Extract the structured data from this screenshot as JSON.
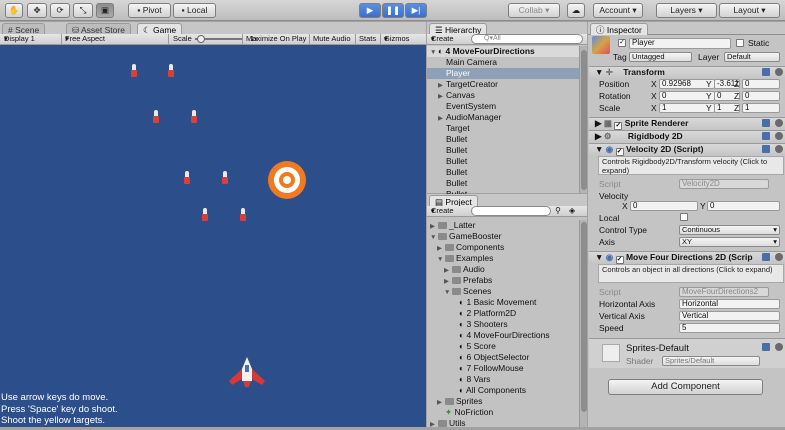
{
  "toolbar": {
    "pivot": "Pivot",
    "local": "Local",
    "collab": "Collab ▾",
    "account": "Account",
    "layers": "Layers",
    "layout": "Layout",
    "tools": [
      "hand-tool-icon",
      "move-tool-icon",
      "rotate-tool-icon",
      "scale-tool-icon",
      "rect-tool-icon"
    ]
  },
  "tabs": {
    "scene": "Scene",
    "asset_store": "Asset Store",
    "game": "Game",
    "hierarchy": "Hierarchy",
    "project": "Project",
    "inspector": "Inspector"
  },
  "game_bar": {
    "display": "Display 1",
    "aspect": "Free Aspect",
    "scale_label": "Scale",
    "scale_value": "1x",
    "maximize": "Maximize On Play",
    "mute": "Mute Audio",
    "stats": "Stats",
    "gizmos": "Gizmos"
  },
  "game_text": [
    "Use arrow keys do move.",
    "Press 'Space' key do shoot.",
    "Shoot the yellow targets."
  ],
  "hierarchy": {
    "create": "Create",
    "search_placeholder": "Q▾All",
    "scene": "4 MoveFourDirections",
    "items": [
      {
        "label": "Main Camera",
        "arrow": ""
      },
      {
        "label": "Player",
        "arrow": ""
      },
      {
        "label": "TargetCreator",
        "arrow": "▶"
      },
      {
        "label": "Canvas",
        "arrow": "▶"
      },
      {
        "label": "EventSystem",
        "arrow": ""
      },
      {
        "label": "AudioManager",
        "arrow": "▶"
      },
      {
        "label": "Target",
        "arrow": ""
      },
      {
        "label": "Bullet",
        "arrow": ""
      },
      {
        "label": "Bullet",
        "arrow": ""
      },
      {
        "label": "Bullet",
        "arrow": ""
      },
      {
        "label": "Bullet",
        "arrow": ""
      },
      {
        "label": "Bullet",
        "arrow": ""
      },
      {
        "label": "Bullet",
        "arrow": ""
      }
    ]
  },
  "project": {
    "create": "Create",
    "items": [
      {
        "label": "_Latter",
        "arrow": "▶",
        "type": "folder"
      },
      {
        "label": "GameBooster",
        "arrow": "▼",
        "type": "folder"
      },
      {
        "label": "Components",
        "arrow": "▶",
        "type": "folder"
      },
      {
        "label": "Examples",
        "arrow": "▼",
        "type": "folder"
      },
      {
        "label": "Audio",
        "arrow": "▶",
        "type": "folder"
      },
      {
        "label": "Prefabs",
        "arrow": "▶",
        "type": "folder"
      },
      {
        "label": "Scenes",
        "arrow": "▼",
        "type": "folder"
      },
      {
        "label": "1 Basic Movement",
        "arrow": "",
        "type": "scene"
      },
      {
        "label": "2 Platform2D",
        "arrow": "",
        "type": "scene"
      },
      {
        "label": "3 Shooters",
        "arrow": "",
        "type": "scene"
      },
      {
        "label": "4 MoveFourDirections",
        "arrow": "",
        "type": "scene"
      },
      {
        "label": "5 Score",
        "arrow": "",
        "type": "scene"
      },
      {
        "label": "6 ObjectSelector",
        "arrow": "",
        "type": "scene"
      },
      {
        "label": "7 FollowMouse",
        "arrow": "",
        "type": "scene"
      },
      {
        "label": "8 Vars",
        "arrow": "",
        "type": "scene"
      },
      {
        "label": "All Components",
        "arrow": "",
        "type": "scene"
      },
      {
        "label": "Sprites",
        "arrow": "▶",
        "type": "folder"
      },
      {
        "label": "NoFriction",
        "arrow": "",
        "type": "material"
      },
      {
        "label": "Utils",
        "arrow": "▶",
        "type": "folder"
      }
    ]
  },
  "inspector": {
    "name": "Player",
    "static": "Static",
    "tag_label": "Tag",
    "tag": "Untagged",
    "layer_label": "Layer",
    "layer": "Default",
    "transform": {
      "title": "Transform",
      "position": "Position",
      "rotation": "Rotation",
      "scale": "Scale",
      "pos": [
        "0.92968",
        "-3.6116",
        "0"
      ],
      "rot": [
        "0",
        "0",
        "0"
      ],
      "scl": [
        "1",
        "1",
        "1"
      ],
      "axes": [
        "X",
        "Y",
        "Z"
      ]
    },
    "sprite_renderer": "Sprite Renderer",
    "rigidbody": "Rigidbody 2D",
    "velocity": {
      "title": "Velocity 2D (Script)",
      "desc": "Controls Rigidbody2D/Transform velocity  (Click to expand)",
      "script_label": "Script",
      "script": "Velocity2D",
      "velocity_label": "Velocity",
      "x_label": "X",
      "x": "0",
      "y_label": "Y",
      "y": "0",
      "local": "Local",
      "control_label": "Control Type",
      "control": "Continuous",
      "axis_label": "Axis",
      "axis": "XY"
    },
    "move": {
      "title": "Move Four Directions 2D (Scrip",
      "desc": "Controls an object in all directions  (Click to expand)",
      "script_label": "Script",
      "script": "MoveFourDirections2",
      "h_label": "Horizontal Axis",
      "h": "Horizontal",
      "v_label": "Vertical Axis",
      "v": "Vertical",
      "speed_label": "Speed",
      "speed": "5"
    },
    "material": {
      "name": "Sprites-Default",
      "shader_label": "Shader",
      "shader": "Sprites/Default"
    },
    "add_component": "Add Component"
  }
}
